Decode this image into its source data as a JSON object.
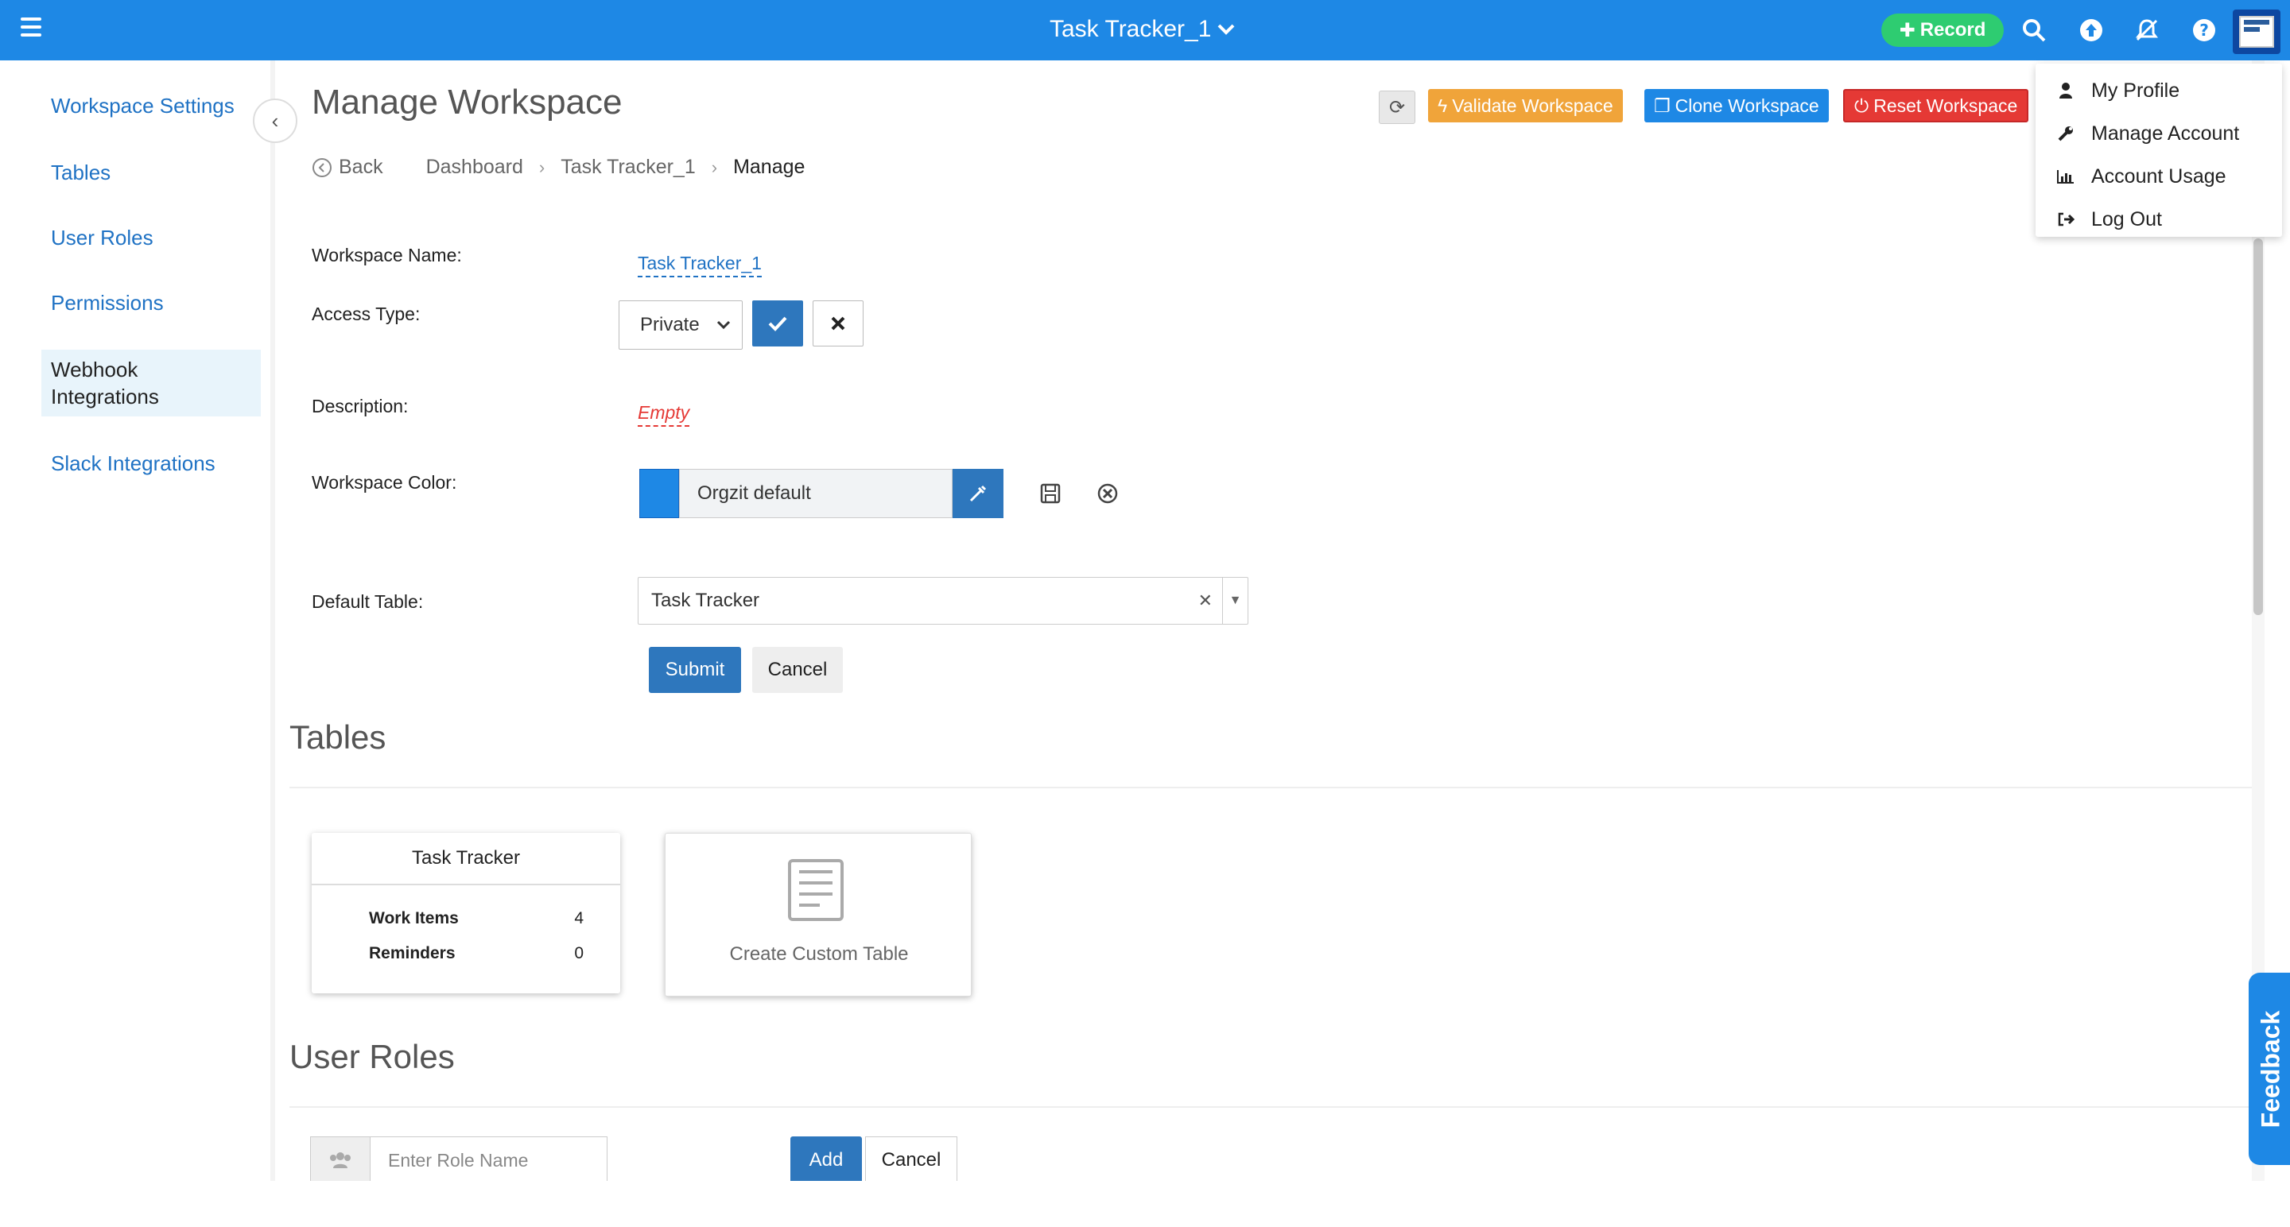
{
  "header": {
    "title": "Task Tracker_1",
    "record_label": "Record"
  },
  "sidebar": {
    "items": [
      {
        "label": "Workspace Settings"
      },
      {
        "label": "Tables"
      },
      {
        "label": "User Roles"
      },
      {
        "label": "Permissions"
      },
      {
        "label": "Webhook Integrations"
      },
      {
        "label": "Slack Integrations"
      }
    ]
  },
  "page": {
    "title": "Manage Workspace",
    "actions": {
      "validate": "Validate Workspace",
      "clone": "Clone Workspace",
      "reset": "Reset Workspace"
    },
    "breadcrumb": {
      "back": "Back",
      "items": [
        "Dashboard",
        "Task Tracker_1",
        "Manage"
      ]
    }
  },
  "form": {
    "workspace_name_label": "Workspace Name:",
    "workspace_name_value": "Task Tracker_1",
    "access_type_label": "Access Type:",
    "access_type_value": "Private",
    "description_label": "Description:",
    "description_value": "Empty",
    "color_label": "Workspace Color:",
    "color_name": "Orgzit default",
    "color_hex": "#1e88e5",
    "default_table_label": "Default Table:",
    "default_table_value": "Task Tracker",
    "submit_label": "Submit",
    "cancel_label": "Cancel"
  },
  "tables_section": {
    "title": "Tables",
    "card": {
      "title": "Task Tracker",
      "rows": [
        {
          "label": "Work Items",
          "value": "4"
        },
        {
          "label": "Reminders",
          "value": "0"
        }
      ]
    },
    "create_label": "Create Custom Table"
  },
  "roles_section": {
    "title": "User Roles",
    "input_placeholder": "Enter Role Name",
    "add_label": "Add",
    "cancel_label": "Cancel"
  },
  "user_menu": {
    "items": [
      {
        "label": "My Profile",
        "icon": "user-icon"
      },
      {
        "label": "Manage Account",
        "icon": "wrench-icon"
      },
      {
        "label": "Account Usage",
        "icon": "bar-chart-icon"
      },
      {
        "label": "Log Out",
        "icon": "logout-icon"
      }
    ]
  },
  "feedback_label": "Feedback",
  "colors": {
    "brand": "#1e88e5",
    "record": "#2ecc71",
    "validate": "#f0a43a",
    "clone": "#1e88e5",
    "reset": "#e53935",
    "primary_button": "#2e77bd"
  }
}
